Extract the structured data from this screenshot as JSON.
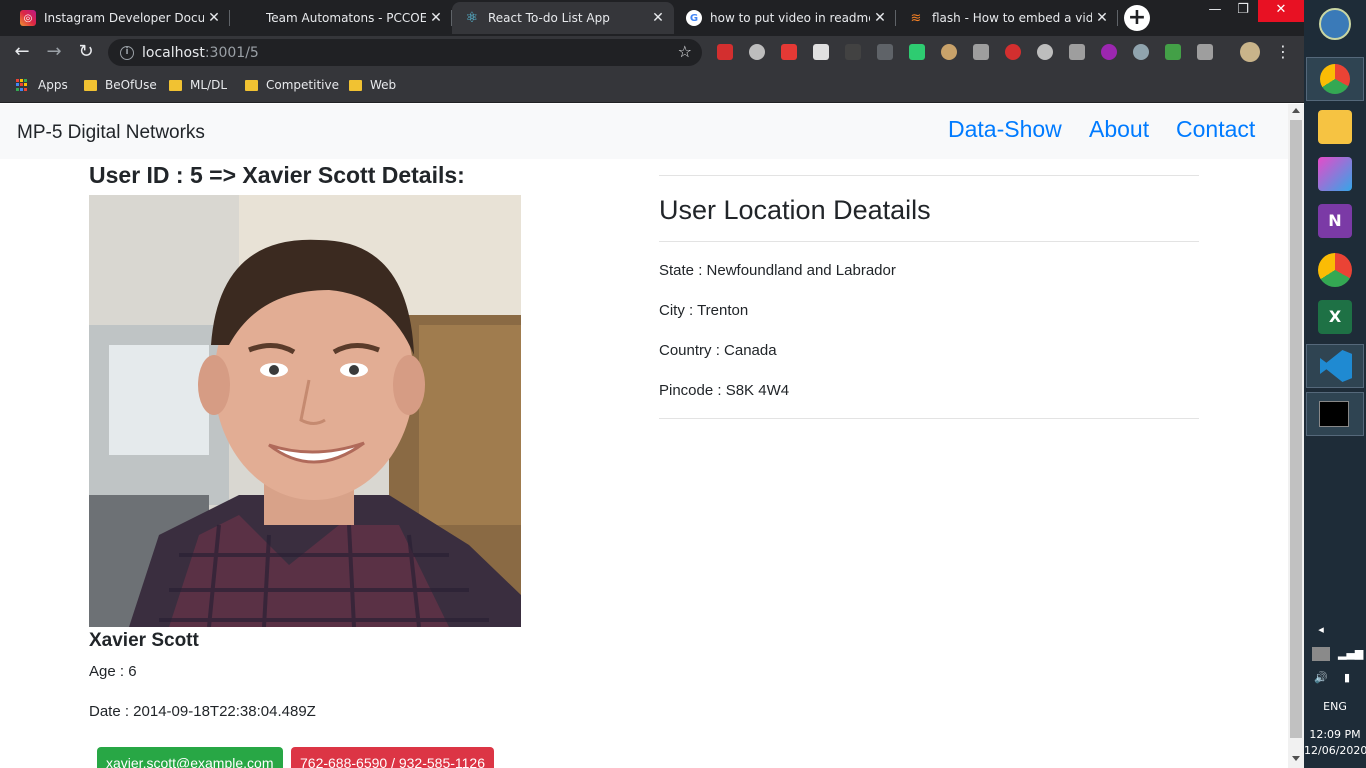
{
  "browser": {
    "tabs": [
      {
        "title": "Instagram Developer Documentation",
        "favicon": "instagram-icon",
        "color": "#c13584"
      },
      {
        "title": "Team Automatons - PCCOE Chakan",
        "favicon": "team-icon",
        "color": "#202124"
      },
      {
        "title": "React To-do List App",
        "favicon": "react-icon",
        "color": "#61dafb"
      },
      {
        "title": "how to put video in readme - Google Search",
        "favicon": "google-icon",
        "color": "#4285f4"
      },
      {
        "title": "flash - How to embed a video",
        "favicon": "stackoverflow-icon",
        "color": "#f48024"
      }
    ],
    "new_tab_label": "+",
    "url_host": "localhost",
    "url_rest": ":3001/5",
    "bookmarks": {
      "apps": "Apps",
      "items": [
        "BeOfUse",
        "ML/DL",
        "Competitive",
        "Web"
      ]
    }
  },
  "app": {
    "brand": "MP-5 Digital Networks",
    "nav": {
      "data_show": "Data-Show",
      "about": "About",
      "contact": "Contact"
    },
    "heading": "User ID : 5 => Xavier Scott Details:",
    "name": "Xavier Scott",
    "age": "Age : 6",
    "date": "Date : 2014-09-18T22:38:04.489Z",
    "email": "xavier.scott@example.com",
    "phone": "762-688-6590 / 932-585-1126",
    "location": {
      "title": "User Location Deatails",
      "state": "State : Newfoundland and Labrador",
      "city": "City : Trenton",
      "country": "Country : Canada",
      "pincode": "Pincode : S8K 4W4"
    }
  },
  "taskbar": {
    "lang": "ENG",
    "time": "12:09 PM",
    "date": "12/06/2020"
  },
  "colors": {
    "link": "#007bff",
    "success": "#28a745",
    "danger": "#dc3545"
  }
}
